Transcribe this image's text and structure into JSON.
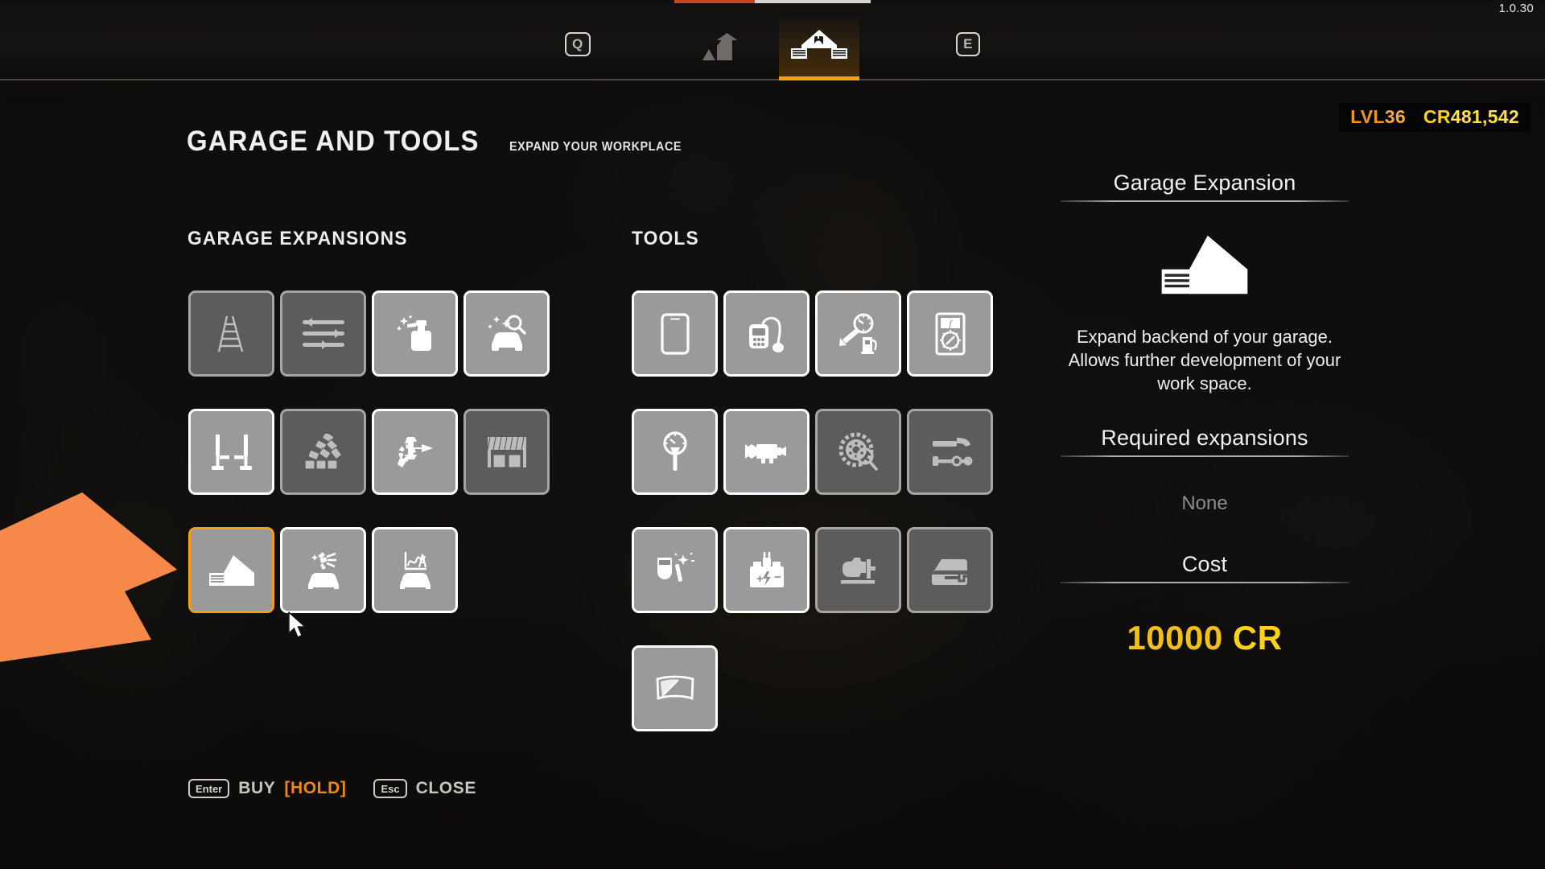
{
  "app": {
    "version": "1.0.30"
  },
  "topbar": {
    "prev_key": "Q",
    "next_key": "E",
    "tabs": [
      {
        "label": "Skills",
        "icon": "skill-bars-icon",
        "active": false
      },
      {
        "label": "Garage and Tools",
        "icon": "garage-icon",
        "active": true
      }
    ]
  },
  "header": {
    "title": "GARAGE AND TOOLS",
    "subtitle": "EXPAND YOUR WORKPLACE"
  },
  "hud": {
    "level_label": "LVL",
    "level_value": "36",
    "credits_label": "CR",
    "credits_value": "481,542"
  },
  "sections": [
    {
      "key": "garage_expansions",
      "title": "GARAGE EXPANSIONS",
      "items": [
        {
          "name": "Ladder",
          "icon": "ladder-icon",
          "state": "dim"
        },
        {
          "name": "Workshop Sliders",
          "icon": "sliders-icon",
          "state": "dim"
        },
        {
          "name": "Cleaning Station",
          "icon": "spray-bottle-icon",
          "state": "avail"
        },
        {
          "name": "Vehicle Inspection",
          "icon": "car-inspect-icon",
          "state": "avail"
        },
        {
          "name": "Car Lift",
          "icon": "car-lift-icon",
          "state": "avail"
        },
        {
          "name": "Brick Wall",
          "icon": "brick-pile-icon",
          "state": "dim"
        },
        {
          "name": "Workbench Tools",
          "icon": "hammer-gear-icon",
          "state": "avail"
        },
        {
          "name": "Garage Door",
          "icon": "garage-door-icon",
          "state": "dim"
        },
        {
          "name": "Garage Expansion",
          "icon": "garage-house-icon",
          "state": "sel"
        },
        {
          "name": "Paint Shop",
          "icon": "paint-gun-car-icon",
          "state": "avail"
        },
        {
          "name": "Dyno Test",
          "icon": "dyno-car-icon",
          "state": "avail"
        }
      ]
    },
    {
      "key": "tools",
      "title": "TOOLS",
      "items": [
        {
          "name": "Tablet",
          "icon": "tablet-icon",
          "state": "avail"
        },
        {
          "name": "OBD Scanner",
          "icon": "obd-scanner-icon",
          "state": "avail"
        },
        {
          "name": "Fuel Pressure Tester",
          "icon": "fuel-gauge-icon",
          "state": "avail"
        },
        {
          "name": "Multimeter",
          "icon": "multimeter-icon",
          "state": "avail"
        },
        {
          "name": "Compression Tester",
          "icon": "compression-gauge-icon",
          "state": "avail"
        },
        {
          "name": "Air Compressor",
          "icon": "compressor-icon",
          "state": "avail"
        },
        {
          "name": "Brake Inspection",
          "icon": "brake-disc-inspect-icon",
          "state": "dim"
        },
        {
          "name": "Body Hammer Set",
          "icon": "body-hammer-icon",
          "state": "dim"
        },
        {
          "name": "Welder",
          "icon": "welding-mask-icon",
          "state": "avail"
        },
        {
          "name": "Battery Charger",
          "icon": "battery-charger-icon",
          "state": "avail"
        },
        {
          "name": "Engine Stand",
          "icon": "engine-stand-icon",
          "state": "dim"
        },
        {
          "name": "Dent Puller",
          "icon": "car-door-dent-icon",
          "state": "dim"
        },
        {
          "name": "Window Tint Kit",
          "icon": "window-film-icon",
          "state": "avail"
        }
      ]
    }
  ],
  "detail": {
    "title": "Garage Expansion",
    "icon": "garage-house-icon",
    "description": "Expand backend of your garage. Allows further development of your work space.",
    "required_title": "Required expansions",
    "required_value": "None",
    "cost_title": "Cost",
    "cost_value": "10000",
    "cost_currency": "CR"
  },
  "keybinds": [
    {
      "key": "Enter",
      "label": "BUY",
      "modifier": "[HOLD]"
    },
    {
      "key": "Esc",
      "label": "CLOSE",
      "modifier": ""
    }
  ],
  "colors": {
    "accent_orange": "#f79e11",
    "credits_yellow": "#ffd21a",
    "level_orange": "#f0951b",
    "annotation_arrow": "#f6894a"
  }
}
